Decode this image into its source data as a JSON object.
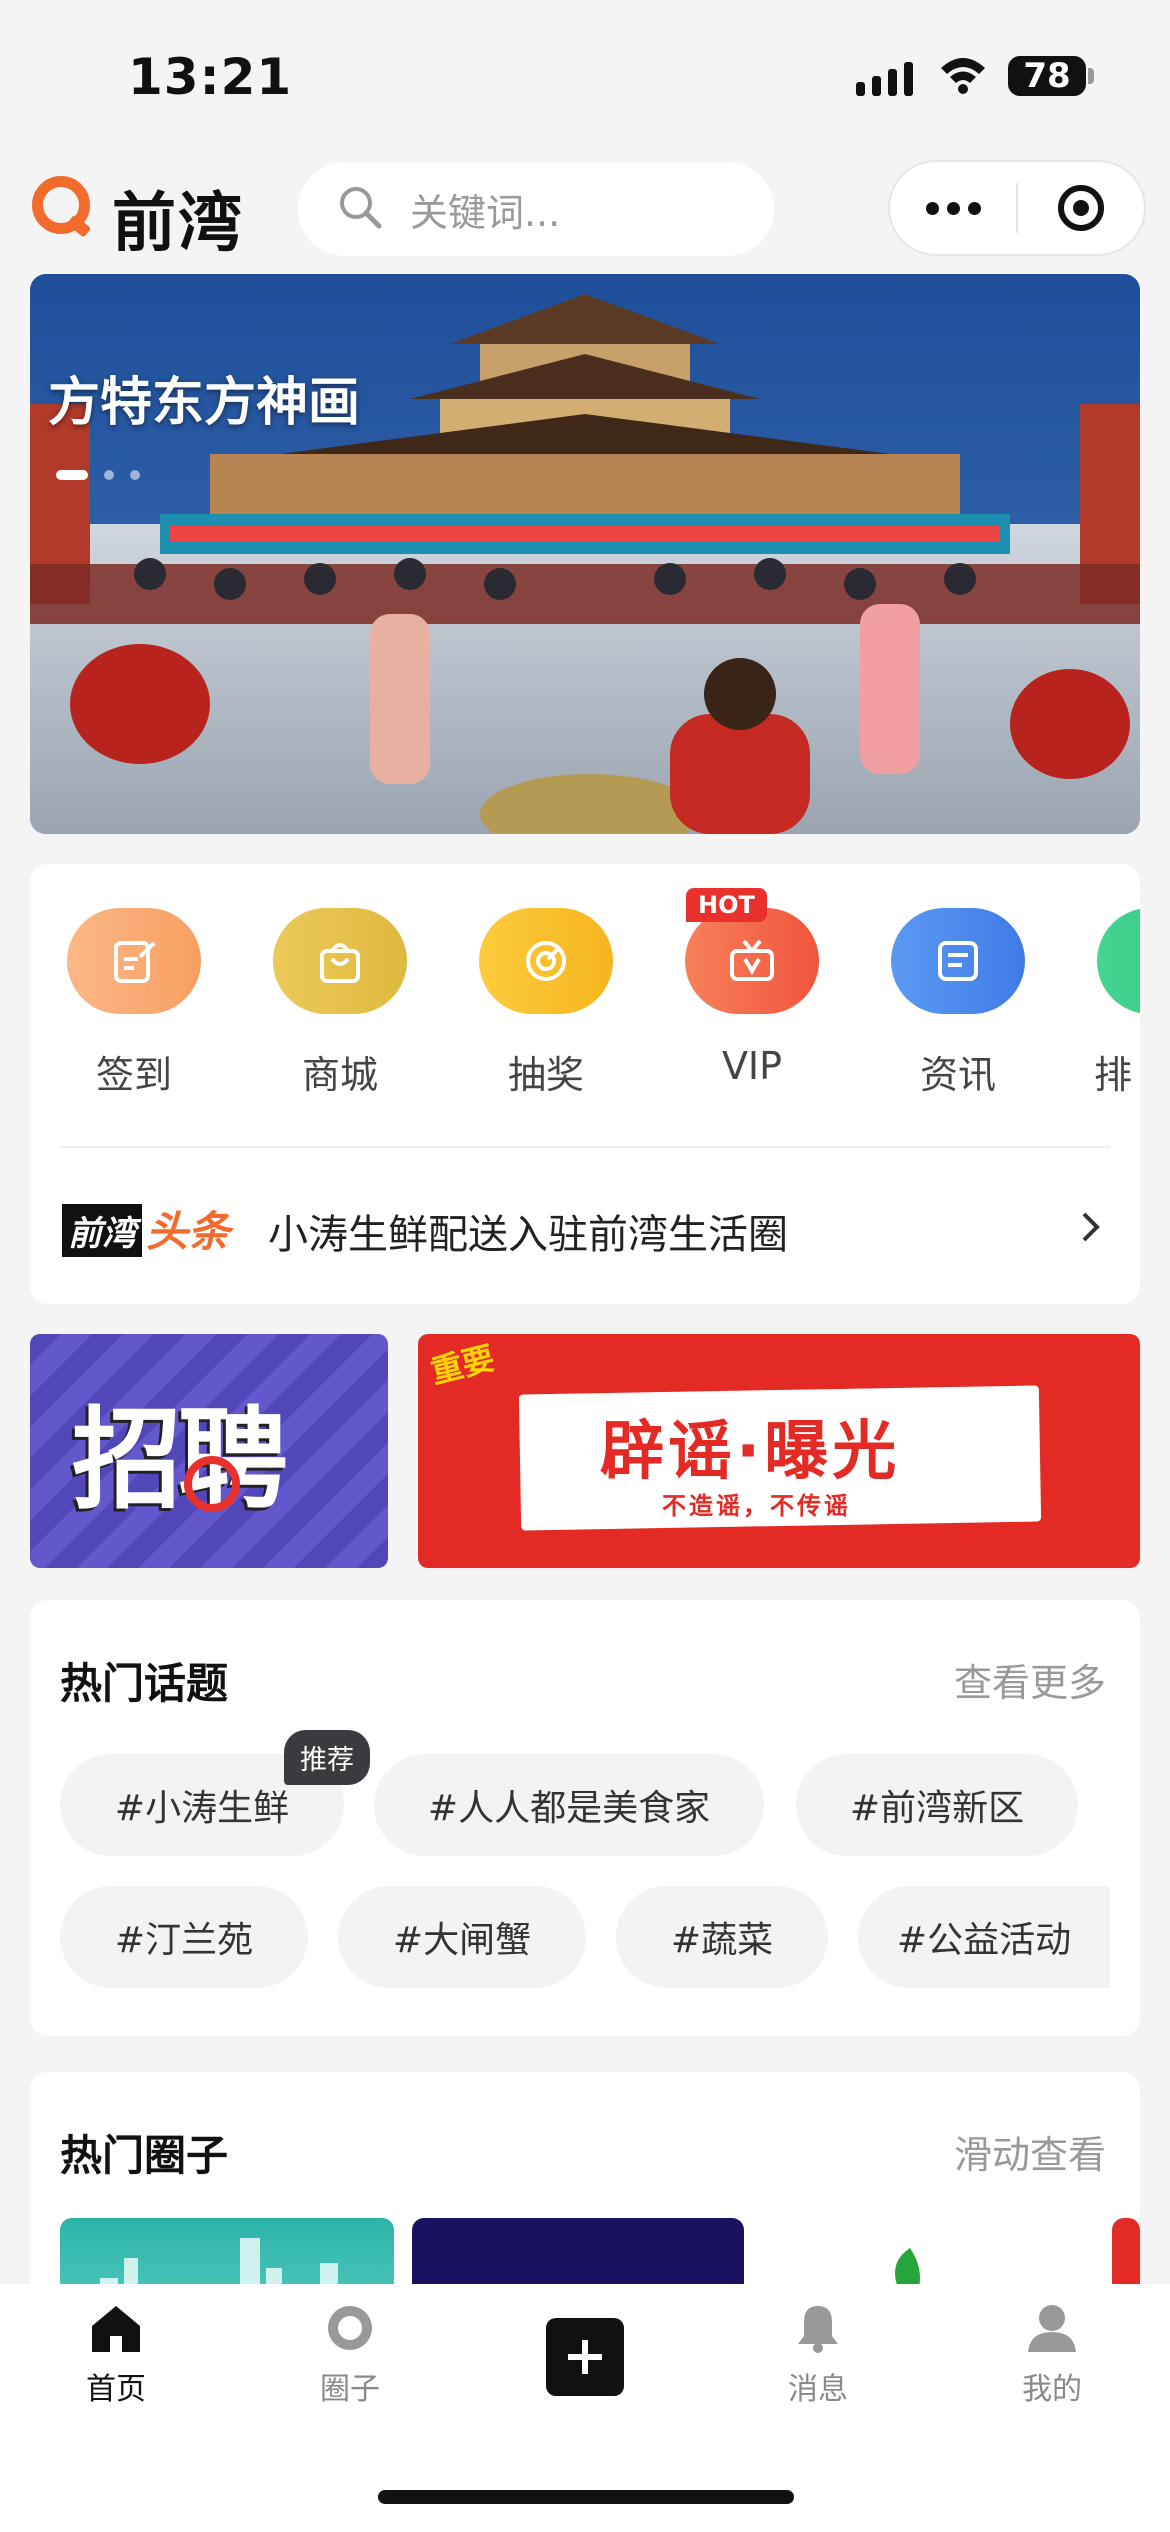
{
  "status_bar": {
    "time": "13:21",
    "battery": "78"
  },
  "header": {
    "logo": "前湾",
    "search_placeholder": "关键词..."
  },
  "banner": {
    "caption": "方特东方神画"
  },
  "quick_menu": [
    {
      "label": "签到",
      "color": "#f9a66c"
    },
    {
      "label": "商城",
      "color": "#e8c04a"
    },
    {
      "label": "抽奖",
      "color": "#f8c234"
    },
    {
      "label": "VIP",
      "color": "#f56a4c",
      "badge": "HOT"
    },
    {
      "label": "资讯",
      "color": "#4d8cf0"
    },
    {
      "label": "排",
      "color": "#3ecb87"
    }
  ],
  "headline": {
    "brand_a": "前湾",
    "brand_b": "头条",
    "text": "小涛生鲜配送入驻前湾生活圈"
  },
  "promos": {
    "left_text": "招聘",
    "right_tag": "重要",
    "right_title": "辟谣·曝光",
    "right_sub": "不造谣，不传谣"
  },
  "hot_topics": {
    "title": "热门话题",
    "more": "查看更多",
    "badge": "推荐",
    "row1": [
      "#小涛生鲜",
      "#人人都是美食家",
      "#前湾新区"
    ],
    "row2": [
      "#汀兰苑",
      "#大闸蟹",
      "#蔬菜",
      "#公益活动"
    ]
  },
  "hot_circles": {
    "title": "热门圈子",
    "more": "滑动查看"
  },
  "tabbar": {
    "home": "首页",
    "circle": "圈子",
    "messages": "消息",
    "mine": "我的"
  }
}
